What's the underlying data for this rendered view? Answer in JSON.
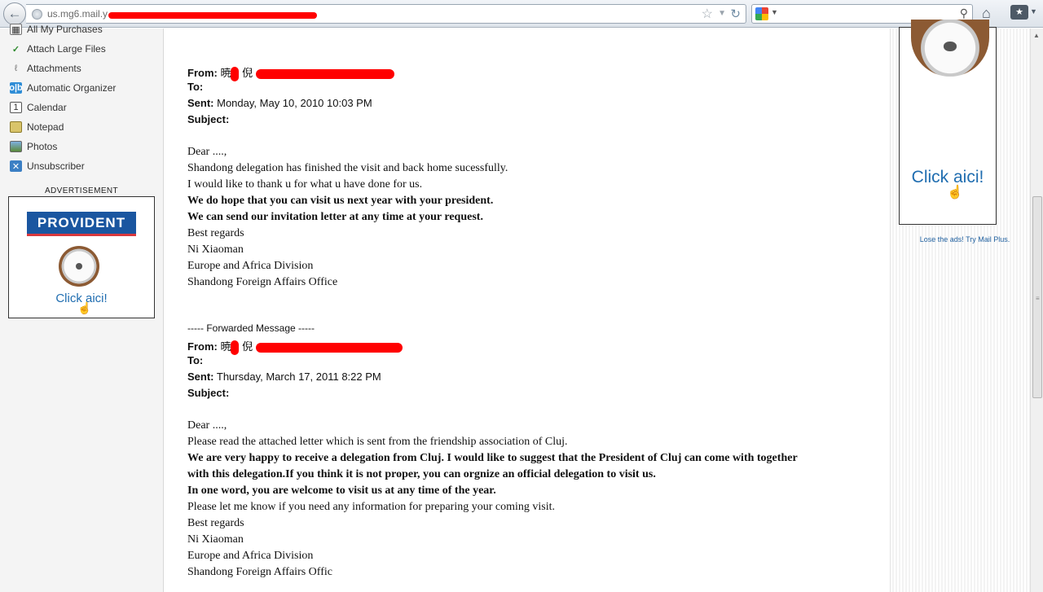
{
  "browser": {
    "url_prefix": "us.mg6.mail.y",
    "search_placeholder": ""
  },
  "sidebar": {
    "items": [
      {
        "label": "All My Purchases",
        "icon": "purchases-icon"
      },
      {
        "label": "Attach Large Files",
        "icon": "attach-large-files-icon"
      },
      {
        "label": "Attachments",
        "icon": "paperclip-icon"
      },
      {
        "label": "Automatic Organizer",
        "icon": "organizer-icon"
      },
      {
        "label": "Calendar",
        "icon": "calendar-icon"
      },
      {
        "label": "Notepad",
        "icon": "notepad-icon"
      },
      {
        "label": "Photos",
        "icon": "photos-icon"
      },
      {
        "label": "Unsubscriber",
        "icon": "unsubscriber-icon"
      }
    ],
    "ad_label": "ADVERTISEMENT",
    "ad": {
      "brand": "PROVIDENT",
      "cta": "Click aici!"
    }
  },
  "right_ad": {
    "cta": "Click aici!",
    "upgrade_link": "Lose the ads! Try Mail Plus."
  },
  "message1": {
    "from_label": "From:",
    "from_name_a": "暁",
    "from_name_b": "倪",
    "to_label": "To:",
    "sent_label": "Sent:",
    "sent_value": "Monday, May 10, 2010 10:03 PM",
    "subject_label": "Subject:",
    "body": [
      {
        "text": "Dear ....,",
        "bold": false
      },
      {
        "text": "Shandong delegation has finished the visit and back home sucessfully.",
        "bold": false
      },
      {
        "text": "I would like to thank u for what u have done for us.",
        "bold": false
      },
      {
        "text": "We do hope that you can visit us next year with your president.",
        "bold": true
      },
      {
        "text": "We can send our invitation letter at any time at your request.",
        "bold": true
      },
      {
        "text": "Best regards",
        "bold": false
      },
      {
        "text": "Ni Xiaoman",
        "bold": false
      },
      {
        "text": "Europe and Africa Division",
        "bold": false
      },
      {
        "text": "Shandong Foreign Affairs Office",
        "bold": false
      }
    ]
  },
  "message2": {
    "forward_header": "----- Forwarded Message -----",
    "from_label": "From:",
    "from_name_a": "暁",
    "from_name_b": "倪",
    "to_label": "To:",
    "sent_label": "Sent:",
    "sent_value": "Thursday, March 17, 2011 8:22 PM",
    "subject_label": "Subject:",
    "body": [
      {
        "text": "Dear ....,",
        "bold": false
      },
      {
        "text": "Please read the attached letter which is sent from the friendship association of Cluj.",
        "bold": false
      },
      {
        "text": "We are very happy to receive a delegation from Cluj. I would like to suggest that the President of  Cluj can come with together",
        "bold": true
      },
      {
        "text": "with this delegation.If you think it is not proper, you can orgnize an official delegation to visit us.",
        "bold": true
      },
      {
        "text": "In one word, you are welcome to visit us at any time of the year.",
        "bold": true
      },
      {
        "text": "Please let me know if you need  any information for preparing your coming visit.",
        "bold": false
      },
      {
        "text": "Best regards",
        "bold": false
      },
      {
        "text": "Ni Xiaoman",
        "bold": false
      },
      {
        "text": "Europe and Africa Division",
        "bold": false
      },
      {
        "text": "Shandong Foreign Affairs Offic",
        "bold": false
      }
    ]
  }
}
